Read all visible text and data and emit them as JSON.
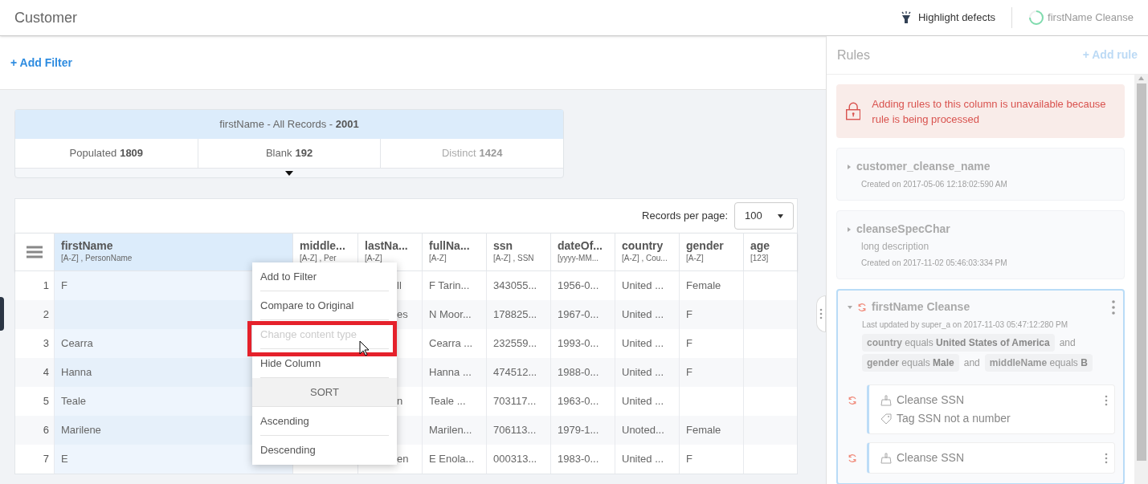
{
  "header": {
    "title": "Customer",
    "highlight_label": "Highlight defects",
    "processing_label": "firstName Cleanse"
  },
  "filter": {
    "add_label": "+ Add Filter"
  },
  "stats": {
    "title": "firstName - All Records - ",
    "total": "2001",
    "items": [
      {
        "label": "Populated ",
        "value": "1809",
        "dimmed": false
      },
      {
        "label": "Blank ",
        "value": "192",
        "dimmed": false
      },
      {
        "label": "Distinct ",
        "value": "1424",
        "dimmed": true
      }
    ]
  },
  "table": {
    "records_label": "Records per page:",
    "records_value": "100",
    "columns": [
      {
        "name": "firstName",
        "type": "[A-Z]  , PersonName",
        "selected": true,
        "clipped": false
      },
      {
        "name": "middle...",
        "type": "[A-Z]  , Per",
        "selected": false,
        "clipped": false
      },
      {
        "name": "lastNa...",
        "type": "[A-Z]",
        "selected": false,
        "clipped": true
      },
      {
        "name": "fullNa...",
        "type": "[A-Z]",
        "selected": false,
        "clipped": false
      },
      {
        "name": "ssn",
        "type": "[A-Z]  , SSN",
        "selected": false,
        "clipped": false
      },
      {
        "name": "dateOf...",
        "type": "[yyyy-MM...",
        "selected": false,
        "clipped": false
      },
      {
        "name": "country",
        "type": "[A-Z]  , Cou...",
        "selected": false,
        "clipped": false
      },
      {
        "name": "gender",
        "type": "[A-Z]",
        "selected": false,
        "clipped": false
      },
      {
        "name": "age",
        "type": "[123]",
        "selected": false,
        "clipped": false
      }
    ],
    "rows": [
      {
        "index": "1",
        "cells": [
          "F",
          null,
          "ll",
          "F Tarin...",
          "343055...",
          "1956-0...",
          "United ...",
          "Female",
          null
        ]
      },
      {
        "index": "2",
        "cells": [
          null,
          null,
          "es",
          "N Moor...",
          "178825...",
          "1967-0...",
          "United ...",
          "F",
          null
        ]
      },
      {
        "index": "3",
        "cells": [
          "Cearra",
          null,
          null,
          "Cearra ...",
          "232559...",
          "1993-0...",
          "United ...",
          "F",
          null
        ]
      },
      {
        "index": "4",
        "cells": [
          "Hanna",
          null,
          null,
          "Hanna ...",
          "474512...",
          "1988-0...",
          "United ...",
          "F",
          null
        ]
      },
      {
        "index": "5",
        "cells": [
          "Teale",
          null,
          "n",
          "Teale ...",
          "703117...",
          "1963-0...",
          "United ...",
          null,
          null
        ]
      },
      {
        "index": "6",
        "cells": [
          "Marilene",
          null,
          null,
          "Marilen...",
          "706113...",
          "1979-1...",
          "Unoted...",
          "Female",
          null
        ]
      },
      {
        "index": "7",
        "cells": [
          "E",
          null,
          "en",
          "E Enola...",
          "000313...",
          "1983-0...",
          "United ...",
          "F",
          null
        ]
      }
    ]
  },
  "context_menu": {
    "items": [
      {
        "kind": "item",
        "label": "Add to Filter",
        "disabled": false
      },
      {
        "kind": "item",
        "label": "Compare to Original",
        "disabled": false
      },
      {
        "kind": "item",
        "label": "Change content type",
        "disabled": true
      },
      {
        "kind": "item",
        "label": "Hide Column",
        "disabled": false
      },
      {
        "kind": "section",
        "label": "SORT"
      },
      {
        "kind": "item",
        "label": "Ascending",
        "disabled": false
      },
      {
        "kind": "item",
        "label": "Descending",
        "disabled": false
      }
    ]
  },
  "rules_panel": {
    "title": "Rules",
    "add_label": "+ Add rule",
    "alert": "Adding rules to this column is unavailable because rule is being processed",
    "rules": [
      {
        "name": "customer_cleanse_name",
        "meta": "Created on 2017-05-06 12:18:02:590 AM",
        "expanded": false,
        "processing": false,
        "selected": false
      },
      {
        "name": "cleanseSpecChar",
        "description": "long description",
        "meta": "Created on 2017-11-02 05:46:03:334 PM",
        "expanded": false,
        "processing": false,
        "selected": false
      },
      {
        "name": "firstName Cleanse",
        "meta": "Last updated by super_a on 2017-11-03 05:47:12:280 PM",
        "expanded": true,
        "processing": true,
        "selected": true,
        "conditions": [
          {
            "field": "country",
            "op": "equals",
            "value": "United States of America",
            "joiner": "and"
          },
          {
            "field": "gender",
            "op": "equals",
            "value": "Male",
            "joiner": "and"
          },
          {
            "field": "middleName",
            "op": "equals",
            "value": "B"
          }
        ],
        "steps": [
          {
            "action": "Cleanse SSN",
            "tag": "Tag SSN not a number",
            "processing": true
          },
          {
            "action": "Cleanse SSN",
            "processing": true
          }
        ]
      }
    ]
  }
}
